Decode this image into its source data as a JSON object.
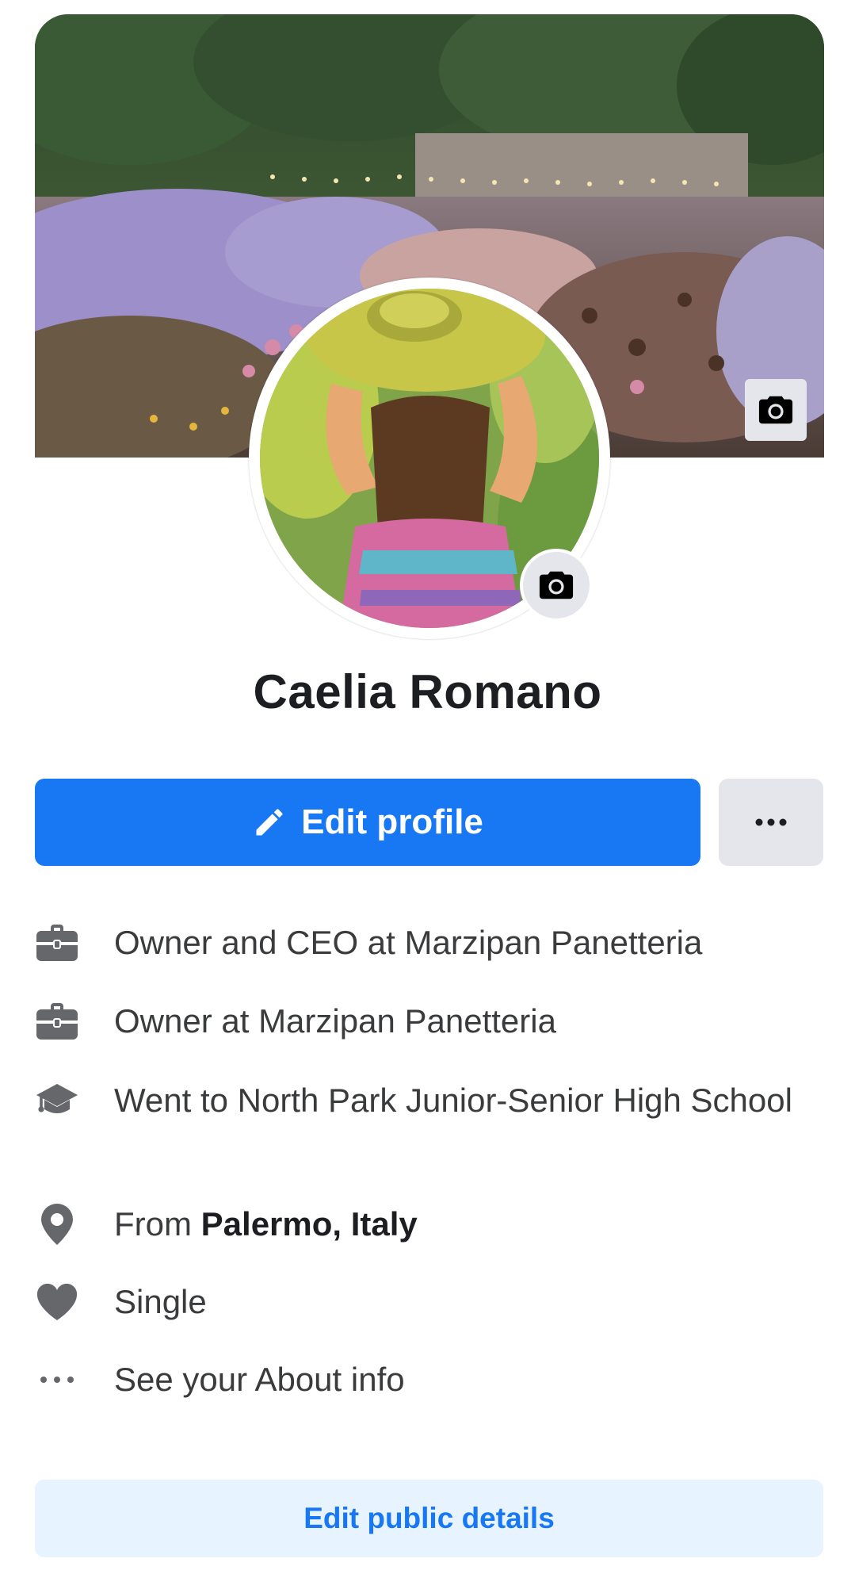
{
  "profile": {
    "name": "Caelia Romano"
  },
  "actions": {
    "edit_profile": "Edit profile",
    "more_icon": "more-dots-icon",
    "edit_public_details": "Edit public details"
  },
  "intro": [
    {
      "icon": "briefcase-icon",
      "text": "Owner and CEO at Marzipan Panetteria"
    },
    {
      "icon": "briefcase-icon",
      "text": "Owner at Marzipan Panetteria"
    },
    {
      "icon": "graduation-cap-icon",
      "text": "Went to North Park Junior-Senior High School"
    },
    {
      "icon": "location-pin-icon",
      "prefix": "From ",
      "bold": "Palermo, Italy"
    },
    {
      "icon": "heart-icon",
      "text": "Single"
    },
    {
      "icon": "more-dots-icon",
      "text": "See your About info"
    }
  ],
  "colors": {
    "primary": "#1877f2",
    "light_blue": "#e7f3ff",
    "gray_button": "#e4e6eb",
    "text_primary": "#1c1e21",
    "text_secondary": "#3a3b3c",
    "icon_gray": "#65676b"
  }
}
